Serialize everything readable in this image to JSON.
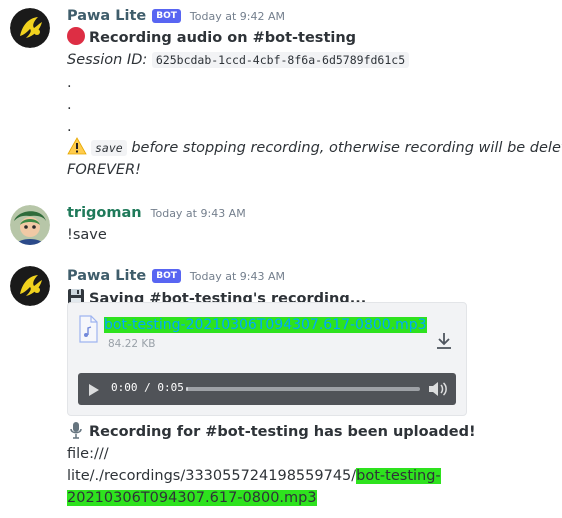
{
  "messages": [
    {
      "author": "Pawa Lite",
      "badge": "BOT",
      "timestamp": "Today at 9:42 AM",
      "title": "Recording audio on #bot-testing",
      "session_label": "Session ID:",
      "session_id": "625bcdab-1ccd-4cbf-8f6a-6d5789fd61c5",
      "dots": [
        ".",
        ".",
        "."
      ],
      "warn_command": "save",
      "warn_text_1": "before stopping recording, otherwise recording will be deleted",
      "warn_text_2": "FOREVER!"
    },
    {
      "author": "trigoman",
      "timestamp": "Today at 9:43 AM",
      "text": "!save"
    },
    {
      "author": "Pawa Lite",
      "badge": "BOT",
      "timestamp": "Today at 9:43 AM",
      "title": "Saving #bot-testing's recording...",
      "attachment": {
        "filename": "bot-testing-20210306T094307.617-0800.mp3",
        "size": "84.22 KB",
        "time": "0:00 / 0:05",
        "progress": 0.01
      },
      "upload_title": "Recording for #bot-testing has been uploaded!",
      "path_1": "file:///",
      "path_2a": "lite/./recordings/333055724198559745/",
      "path_2b": "bot-testing-",
      "path_3": "20210306T094307.617-0800.mp3"
    }
  ],
  "colors": {
    "highlight": "#2ee21e",
    "bot_badge": "#5865f2",
    "link": "#00a8fc"
  },
  "icons": [
    "pawa-avatar",
    "trigoman-avatar",
    "red-circle-icon",
    "warning-icon",
    "floppy-disk-icon",
    "audio-file-icon",
    "download-icon",
    "play-icon",
    "volume-icon",
    "microphone-icon"
  ]
}
